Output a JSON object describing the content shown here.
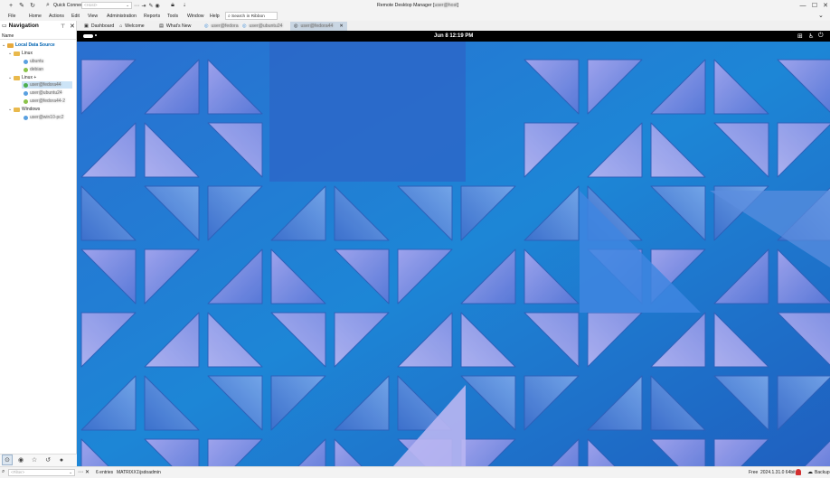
{
  "titlebar": {
    "quick_connect_label": "Quick Connect",
    "quick_connect_placeholder": "<Host>",
    "title": "Remote Desktop Manager [",
    "title_blurred": "user@host",
    "title_end": "]",
    "minimize": "—",
    "maximize": "☐",
    "close": "✕"
  },
  "menu": {
    "items": [
      "File",
      "Home",
      "Actions",
      "Edit",
      "View",
      "Administration",
      "Reports",
      "Tools",
      "Window",
      "Help"
    ],
    "search_placeholder": "Search in Ribbon"
  },
  "tabs": [
    {
      "label": "Dashboard",
      "icon": "dashboard-icon"
    },
    {
      "label": "Welcome",
      "icon": "home-icon"
    },
    {
      "label": "What's New",
      "icon": "news-icon"
    },
    {
      "label": "user@fedora",
      "icon": "session-icon",
      "blurred": true
    },
    {
      "label": "user@ubuntu24",
      "icon": "session-icon",
      "blurred": true
    },
    {
      "label": "user@fedora44",
      "icon": "session-icon",
      "blurred": true,
      "active": true,
      "closable": true
    }
  ],
  "sidebar": {
    "title": "Navigation",
    "column_header": "Name",
    "data_source": "Local Data Source",
    "tree": [
      {
        "label": "Linux",
        "type": "folder",
        "children": [
          {
            "label": "ubuntu",
            "blurred": true,
            "color": "#5aa0e0"
          },
          {
            "label": "debian",
            "blurred": true,
            "color": "#8bc34a"
          }
        ]
      },
      {
        "label": "Linux +",
        "type": "folder",
        "children": [
          {
            "label": "user@fedora44",
            "blurred": true,
            "color": "#4caf50",
            "selected": true
          },
          {
            "label": "user@ubuntu24",
            "blurred": true,
            "color": "#5aa0e0"
          },
          {
            "label": "user@fedora44-2",
            "blurred": true,
            "color": "#8bc34a"
          }
        ]
      },
      {
        "label": "Windows",
        "type": "folder",
        "children": [
          {
            "label": "user@win10-pc2",
            "blurred": true,
            "color": "#5aa0e0"
          }
        ]
      }
    ]
  },
  "remote": {
    "gnome_activities": "",
    "clock": "Jun 8  12:19 PM"
  },
  "status": {
    "filter_placeholder": "<Filter>",
    "entries": "6 entries",
    "user": "MATRIXX1\\jsdoadmin",
    "license": "Free",
    "version": "2024.1.31.0 64bit",
    "backup": "Backup"
  },
  "colors": {
    "wallpaper_base": "#1f7bd0",
    "accent": "#0063b1",
    "selected_row": "#cce4f7"
  }
}
